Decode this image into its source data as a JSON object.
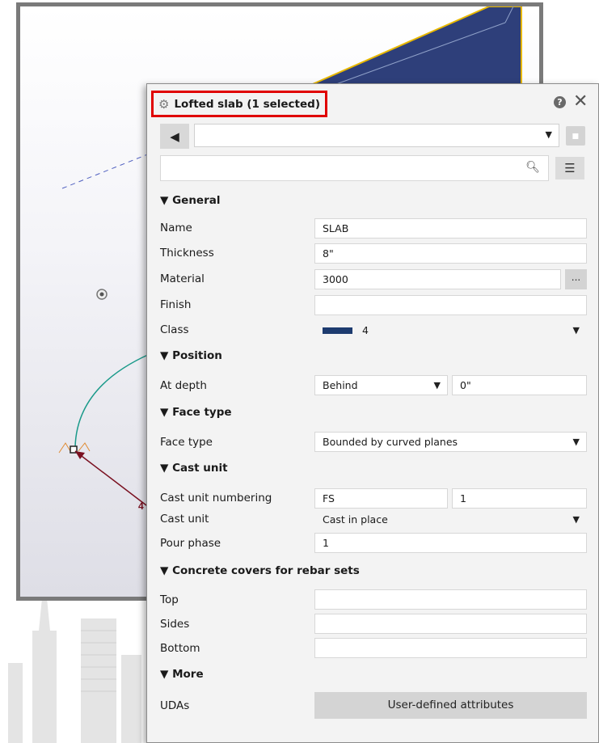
{
  "panel": {
    "title": "Lofted slab (1 selected)",
    "help_glyph": "?",
    "close_glyph": "✕",
    "back_glyph": "◀",
    "preset_value": "",
    "search_placeholder": "",
    "menu_glyph": "☰"
  },
  "sections": {
    "general": "▼ General",
    "position": "▼ Position",
    "face_type": "▼ Face type",
    "cast_unit": "▼ Cast unit",
    "covers": "▼ Concrete covers for rebar sets",
    "more": "▼ More"
  },
  "general": {
    "name_label": "Name",
    "name_value": "SLAB",
    "thickness_label": "Thickness",
    "thickness_value": "8\"",
    "material_label": "Material",
    "material_value": "3000",
    "material_more": "...",
    "finish_label": "Finish",
    "finish_value": "",
    "class_label": "Class",
    "class_value": "4",
    "class_color": "#1d3b6f"
  },
  "position": {
    "at_depth_label": "At depth",
    "at_depth_value": "Behind",
    "at_depth_offset": "0\""
  },
  "face_type": {
    "face_type_label": "Face type",
    "face_type_value": "Bounded by curved planes"
  },
  "cast_unit": {
    "numbering_label": "Cast unit numbering",
    "numbering_prefix": "FS",
    "numbering_start": "1",
    "cast_unit_label": "Cast unit",
    "cast_unit_value": "Cast in place",
    "pour_phase_label": "Pour phase",
    "pour_phase_value": "1"
  },
  "covers": {
    "top_label": "Top",
    "top_value": "",
    "sides_label": "Sides",
    "sides_value": "",
    "bottom_label": "Bottom",
    "bottom_value": ""
  },
  "more": {
    "udas_label": "UDAs",
    "udas_button": "User-defined attributes"
  },
  "viewport": {
    "dimension_text": "4",
    "slab_color": "#2e3f7a",
    "highlight_color": "#e8b800",
    "arc_color": "#1a9a8a",
    "dim_color": "#7a1020"
  }
}
